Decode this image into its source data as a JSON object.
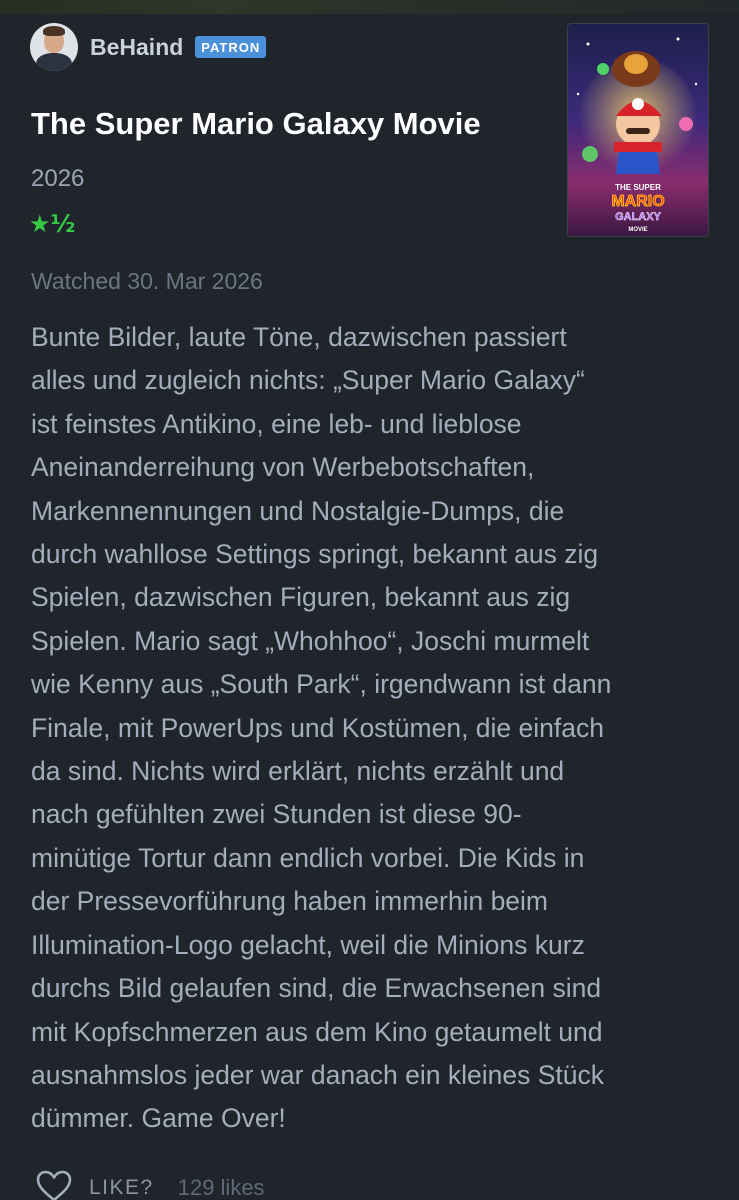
{
  "header": {
    "username": "BeHaind",
    "badge": "PATRON"
  },
  "film": {
    "title": "The Super Mario Galaxy Movie",
    "year": "2026",
    "rating_stars": "★½",
    "rating_value": 1.5,
    "poster_icon": "movie-poster-image",
    "poster_text": "THE SUPER MARIO GALAXY MOVIE"
  },
  "review": {
    "watched": "Watched 30. Mar 2026",
    "lines": [
      "Bunte Bilder, laute Töne, dazwischen passiert",
      "alles und zugleich nichts: „Super Mario Galaxy“",
      "ist feinstes Antikino, eine leb- und lieblose",
      "Aneinanderreihung von Werbebotschaften,",
      "Markennennungen und Nostalgie-Dumps, die",
      "durch wahllose Settings springt, bekannt aus zig",
      "Spielen, dazwischen Figuren, bekannt aus zig",
      "Spielen. Mario sagt „Whohhoo“, Joschi murmelt",
      "wie Kenny aus „South Park“, irgendwann ist dann",
      "Finale, mit PowerUps und Kostümen, die einfach",
      "da sind. Nichts wird erklärt, nichts erzählt und",
      "nach gefühlten zwei Stunden ist diese 90-",
      "minütige Tortur dann endlich vorbei. Die Kids in",
      "der Pressevorführung haben immerhin beim",
      "Illumination-Logo gelacht, weil die Minions kurz",
      "durchs Bild gelaufen sind, die Erwachsenen sind",
      "mit Kopfschmerzen aus dem Kino getaumelt und",
      "ausnahmslos jeder war danach ein kleines Stück",
      "dümmer. Game Over!"
    ]
  },
  "actions": {
    "like_label": "LIKE?",
    "likes_count": "129 likes",
    "heart_icon": "heart-outline-icon"
  },
  "colors": {
    "background": "#20242b",
    "patron_badge": "#4b91d9",
    "star_green": "#35c944",
    "title_white": "#ffffff"
  }
}
